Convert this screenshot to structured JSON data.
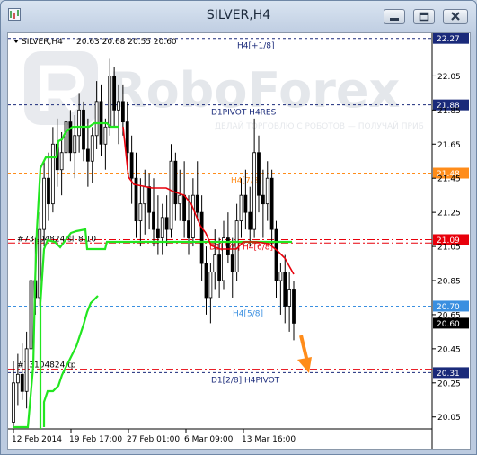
{
  "window": {
    "title": "SILVER,H4"
  },
  "chart_header": {
    "symbol": "SILVER,H4",
    "ohlc": "20.63 20.68 20.55 20.60"
  },
  "watermark": {
    "brand": "RoboForex",
    "tagline": "ДЕЛАЙ ТОРГОВЛЮ С РОБОТОВ — ПОЛУЧАЙ ПРИБ"
  },
  "colors": {
    "red": "#e8000b",
    "green": "#22e620",
    "orange": "#ff8c1a",
    "navy": "#1a2a7a",
    "lightblue": "#3a8fe0",
    "candle": "#000000"
  },
  "chart_data": {
    "type": "candlestick",
    "symbol": "SILVER",
    "timeframe": "H4",
    "ylim": [
      19.98,
      22.3
    ],
    "y_ticks": [
      "22.05",
      "21.85",
      "21.65",
      "21.45",
      "21.25",
      "21.05",
      "20.85",
      "20.65",
      "20.45",
      "20.25",
      "20.05"
    ],
    "y_tick_values": [
      22.05,
      21.85,
      21.65,
      21.45,
      21.25,
      21.05,
      20.85,
      20.65,
      20.45,
      20.25,
      20.05
    ],
    "x_ticks": [
      "12 Feb 2014",
      "19 Feb 17:00",
      "27 Feb 01:00",
      "6 Mar 09:00",
      "13 Mar 16:00"
    ],
    "levels": [
      {
        "label": "H4[+1/8]",
        "value": 22.27,
        "tag": "22.27",
        "color": "#1a2a7a",
        "style": "dash"
      },
      {
        "label": "D1PIVOT H4RES",
        "value": 21.88,
        "tag": "21.88",
        "color": "#1a2a7a",
        "style": "dash"
      },
      {
        "label": "H4[7/8]",
        "value": 21.48,
        "tag": "21.48",
        "color": "#ff8c1a",
        "style": "dash"
      },
      {
        "label": "D1[3/8] H4[6/8]",
        "value": 21.09,
        "tag": "21.09",
        "color": "#e8000b",
        "style": "dashdot"
      },
      {
        "label": "H4[5/8]",
        "value": 20.7,
        "tag": "20.70",
        "color": "#3a8fe0",
        "style": "dash"
      },
      {
        "label": "D1[2/8] H4PIVOT",
        "value": 20.31,
        "tag": "20.31",
        "color": "#1a2a7a",
        "style": "dash"
      }
    ],
    "current_price": {
      "value": 20.6,
      "tag": "20.60"
    },
    "order_lines": [
      {
        "label": "#73104824 sl",
        "value": 21.07,
        "extra": "8.10"
      },
      {
        "label": "#73104824 tp",
        "value": 20.33
      }
    ],
    "candles": [
      [
        20.02,
        20.38,
        19.99,
        20.25
      ],
      [
        20.25,
        20.42,
        20.12,
        20.3
      ],
      [
        20.3,
        20.48,
        20.15,
        20.2
      ],
      [
        20.2,
        20.55,
        20.1,
        20.45
      ],
      [
        20.45,
        20.95,
        20.38,
        20.85
      ],
      [
        20.85,
        21.1,
        20.65,
        20.75
      ],
      [
        20.75,
        21.25,
        20.7,
        21.15
      ],
      [
        21.15,
        21.55,
        21.05,
        21.45
      ],
      [
        21.45,
        21.6,
        21.2,
        21.3
      ],
      [
        21.3,
        21.75,
        21.25,
        21.65
      ],
      [
        21.65,
        21.8,
        21.4,
        21.5
      ],
      [
        21.5,
        21.72,
        21.35,
        21.6
      ],
      [
        21.6,
        21.9,
        21.5,
        21.78
      ],
      [
        21.78,
        21.85,
        21.55,
        21.6
      ],
      [
        21.6,
        21.82,
        21.45,
        21.7
      ],
      [
        21.7,
        21.95,
        21.6,
        21.85
      ],
      [
        21.85,
        21.9,
        21.55,
        21.62
      ],
      [
        21.62,
        21.8,
        21.4,
        21.55
      ],
      [
        21.55,
        21.75,
        21.42,
        21.7
      ],
      [
        21.7,
        22.02,
        21.62,
        21.9
      ],
      [
        21.9,
        22.0,
        21.58,
        21.65
      ],
      [
        21.65,
        21.8,
        21.5,
        21.75
      ],
      [
        21.75,
        22.15,
        21.7,
        22.05
      ],
      [
        22.05,
        22.1,
        21.75,
        21.85
      ],
      [
        21.85,
        22.0,
        21.65,
        21.9
      ],
      [
        21.9,
        22.0,
        21.7,
        21.78
      ],
      [
        21.78,
        21.9,
        21.5,
        21.6
      ],
      [
        21.6,
        21.7,
        21.3,
        21.45
      ],
      [
        21.45,
        21.6,
        21.1,
        21.2
      ],
      [
        21.2,
        21.45,
        21.05,
        21.3
      ],
      [
        21.3,
        21.5,
        21.12,
        21.4
      ],
      [
        21.4,
        21.48,
        21.15,
        21.25
      ],
      [
        21.25,
        21.45,
        21.05,
        21.15
      ],
      [
        21.15,
        21.35,
        21.0,
        21.1
      ],
      [
        21.1,
        21.3,
        21.0,
        21.22
      ],
      [
        21.22,
        21.35,
        21.05,
        21.15
      ],
      [
        21.15,
        21.65,
        21.1,
        21.55
      ],
      [
        21.55,
        21.6,
        21.2,
        21.3
      ],
      [
        21.3,
        21.5,
        21.2,
        21.35
      ],
      [
        21.35,
        21.55,
        21.1,
        21.2
      ],
      [
        21.2,
        21.35,
        21.0,
        21.1
      ],
      [
        21.1,
        21.45,
        21.05,
        21.35
      ],
      [
        21.35,
        21.55,
        21.2,
        21.25
      ],
      [
        21.25,
        21.35,
        20.85,
        20.95
      ],
      [
        20.95,
        21.05,
        20.65,
        20.75
      ],
      [
        20.75,
        20.95,
        20.6,
        20.9
      ],
      [
        20.9,
        21.15,
        20.8,
        21.0
      ],
      [
        21.0,
        21.1,
        20.75,
        20.85
      ],
      [
        20.85,
        21.2,
        20.8,
        21.1
      ],
      [
        21.1,
        21.25,
        20.95,
        21.0
      ],
      [
        21.0,
        21.1,
        20.75,
        20.9
      ],
      [
        20.9,
        21.3,
        20.85,
        21.2
      ],
      [
        21.2,
        21.45,
        21.1,
        21.35
      ],
      [
        21.35,
        21.5,
        21.15,
        21.25
      ],
      [
        21.25,
        21.4,
        21.05,
        21.15
      ],
      [
        21.15,
        21.8,
        21.1,
        21.6
      ],
      [
        21.6,
        21.7,
        21.25,
        21.35
      ],
      [
        21.35,
        21.5,
        21.1,
        21.3
      ],
      [
        21.3,
        21.55,
        21.2,
        21.45
      ],
      [
        21.45,
        21.5,
        21.05,
        21.15
      ],
      [
        21.15,
        21.2,
        20.75,
        20.85
      ],
      [
        20.85,
        20.95,
        20.65,
        20.9
      ],
      [
        20.9,
        21.0,
        20.6,
        20.7
      ],
      [
        20.7,
        20.9,
        20.55,
        20.8
      ],
      [
        20.8,
        20.85,
        20.5,
        20.6
      ]
    ]
  }
}
